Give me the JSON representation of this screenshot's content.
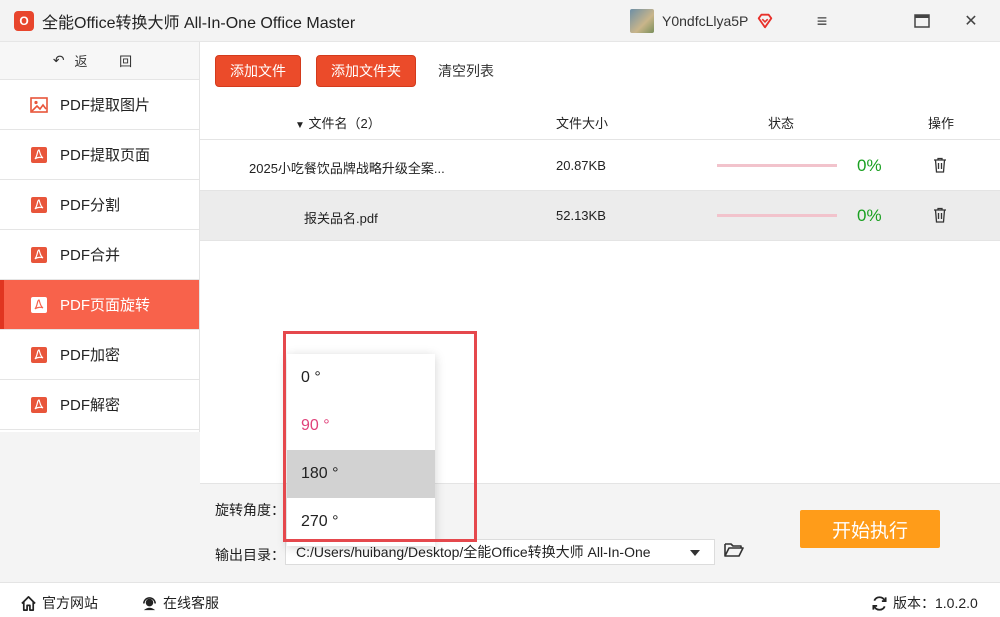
{
  "app": {
    "logo_text": "O",
    "title": "全能Office转换大师 All-In-One Office Master",
    "username": "Y0ndfcLlya5P",
    "menu_icon": "≡",
    "maximize_icon": "▭",
    "close_icon": "✕"
  },
  "sidebar": {
    "back_label": "返 回",
    "items": [
      {
        "label": "PDF提取图片",
        "icon": "image-icon"
      },
      {
        "label": "PDF提取页面",
        "icon": "pdf-icon"
      },
      {
        "label": "PDF分割",
        "icon": "pdf-icon"
      },
      {
        "label": "PDF合并",
        "icon": "pdf-icon"
      },
      {
        "label": "PDF页面旋转",
        "icon": "pdf-icon",
        "active": true
      },
      {
        "label": "PDF加密",
        "icon": "pdf-icon"
      },
      {
        "label": "PDF解密",
        "icon": "pdf-icon"
      }
    ]
  },
  "toolbar": {
    "add_file": "添加文件",
    "add_folder": "添加文件夹",
    "clear_list": "清空列表"
  },
  "table": {
    "headers": {
      "filename": "文件名（2）",
      "size": "文件大小",
      "status": "状态",
      "action": "操作"
    },
    "rows": [
      {
        "name": "2025小吃餐饮品牌战略升级全案...",
        "size": "20.87KB",
        "progress": 0,
        "percent": "0%"
      },
      {
        "name": "报关品名.pdf",
        "size": "52.13KB",
        "progress": 0,
        "percent": "0%"
      }
    ]
  },
  "settings": {
    "rotate_label": "旋转角度：",
    "output_label": "输出目录：",
    "output_path": "C:/Users/huibang/Desktop/全能Office转换大师 All-In-One",
    "start_button": "开始执行"
  },
  "rotation_dropdown": {
    "options": [
      "0 °",
      "90 °",
      "180 °",
      "270 °"
    ],
    "selected": "90 °",
    "hovered": "180 °"
  },
  "statusbar": {
    "website": "官方网站",
    "support": "在线客服",
    "version": "版本：1.0.2.0"
  },
  "colors": {
    "accent_red": "#eb4b2a",
    "sidebar_active": "#f8624b",
    "start_orange": "#ff9c19",
    "percent_green": "#1aa021",
    "selected_pink": "#e0417a",
    "highlight_border": "#e5484d"
  }
}
